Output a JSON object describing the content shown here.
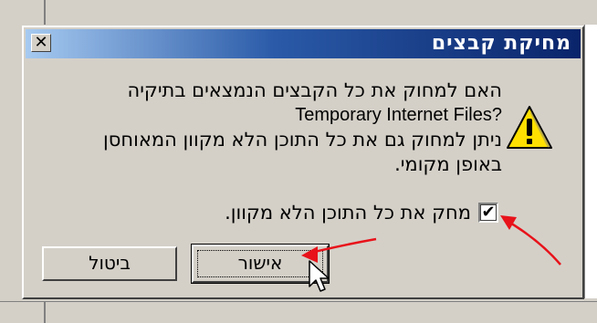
{
  "dialog": {
    "title": "מחיקת קבצים",
    "close_glyph": "✕",
    "message": {
      "line1": "האם למחוק את כל הקבצים הנמצאים בתיקיה",
      "line2": "?Temporary Internet Files",
      "line3": "ניתן למחוק גם את כל התוכן הלא מקוון המאוחסן",
      "line4": "באופן מקומי."
    },
    "checkbox": {
      "label": "מחק את כל התוכן הלא מקוון.",
      "checked": true,
      "glyph": "✔"
    },
    "buttons": {
      "ok_label": "אישור",
      "cancel_label": "ביטול"
    },
    "icon": "warning-icon"
  },
  "colors": {
    "titlebar_dark": "#0a246a",
    "titlebar_light": "#a6caf0",
    "face": "#d4d0c8",
    "annotation_arrow": "#e8121a"
  }
}
